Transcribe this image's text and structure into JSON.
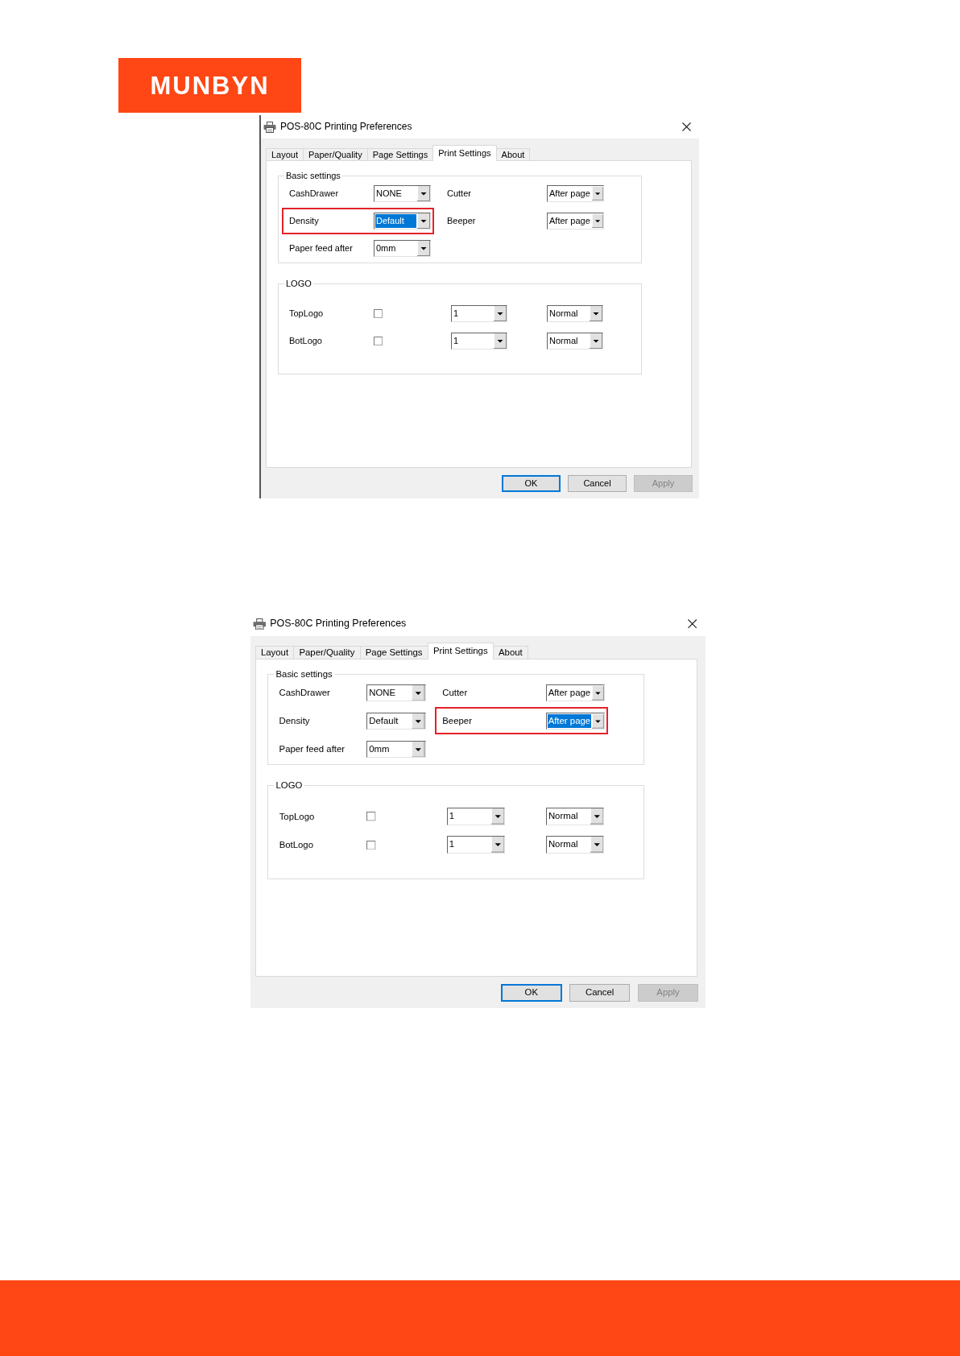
{
  "brand": {
    "logo": "MUNBYN"
  },
  "dialogs": [
    {
      "title": "POS-80C Printing Preferences",
      "tabs": [
        {
          "label": "Layout",
          "selected": false
        },
        {
          "label": "Paper/Quality",
          "selected": false
        },
        {
          "label": "Page Settings",
          "selected": false
        },
        {
          "label": "Print Settings",
          "selected": true
        },
        {
          "label": "About",
          "selected": false
        }
      ],
      "basic_settings": {
        "title": "Basic settings",
        "rows": [
          {
            "fields": [
              {
                "label": "CashDrawer",
                "value": "NONE",
                "highlighted": false,
                "focused": false
              },
              {
                "label": "Cutter",
                "value": "After page",
                "highlighted": false,
                "focused": false
              }
            ]
          },
          {
            "fields": [
              {
                "label": "Density",
                "value": "Default",
                "highlighted": true,
                "focused": true
              },
              {
                "label": "Beeper",
                "value": "After page",
                "highlighted": false,
                "focused": false
              }
            ]
          },
          {
            "fields": [
              {
                "label": "Paper feed after",
                "value": "0mm",
                "highlighted": false,
                "focused": false
              }
            ]
          }
        ]
      },
      "logo": {
        "title": "LOGO",
        "rows": [
          {
            "label": "TopLogo",
            "checked": false,
            "values": [
              "1",
              "Normal"
            ]
          },
          {
            "label": "BotLogo",
            "checked": false,
            "values": [
              "1",
              "Normal"
            ]
          }
        ]
      },
      "buttons": [
        {
          "label": "OK",
          "default": true,
          "disabled": false
        },
        {
          "label": "Cancel",
          "default": false,
          "disabled": false
        },
        {
          "label": "Apply",
          "default": false,
          "disabled": true
        }
      ]
    },
    {
      "title": "POS-80C Printing Preferences",
      "tabs": [
        {
          "label": "Layout",
          "selected": false
        },
        {
          "label": "Paper/Quality",
          "selected": false
        },
        {
          "label": "Page Settings",
          "selected": false
        },
        {
          "label": "Print Settings",
          "selected": true
        },
        {
          "label": "About",
          "selected": false
        }
      ],
      "basic_settings": {
        "title": "Basic settings",
        "rows": [
          {
            "fields": [
              {
                "label": "CashDrawer",
                "value": "NONE",
                "highlighted": false,
                "focused": false
              },
              {
                "label": "Cutter",
                "value": "After page",
                "highlighted": false,
                "focused": false
              }
            ]
          },
          {
            "fields": [
              {
                "label": "Density",
                "value": "Default",
                "highlighted": false,
                "focused": false
              },
              {
                "label": "Beeper",
                "value": "After page",
                "highlighted": true,
                "focused": true
              }
            ]
          },
          {
            "fields": [
              {
                "label": "Paper feed after",
                "value": "0mm",
                "highlighted": false,
                "focused": false
              }
            ]
          }
        ]
      },
      "logo": {
        "title": "LOGO",
        "rows": [
          {
            "label": "TopLogo",
            "checked": false,
            "values": [
              "1",
              "Normal"
            ]
          },
          {
            "label": "BotLogo",
            "checked": false,
            "values": [
              "1",
              "Normal"
            ]
          }
        ]
      },
      "buttons": [
        {
          "label": "OK",
          "default": true,
          "disabled": false
        },
        {
          "label": "Cancel",
          "default": false,
          "disabled": false
        },
        {
          "label": "Apply",
          "default": false,
          "disabled": true
        }
      ]
    }
  ]
}
